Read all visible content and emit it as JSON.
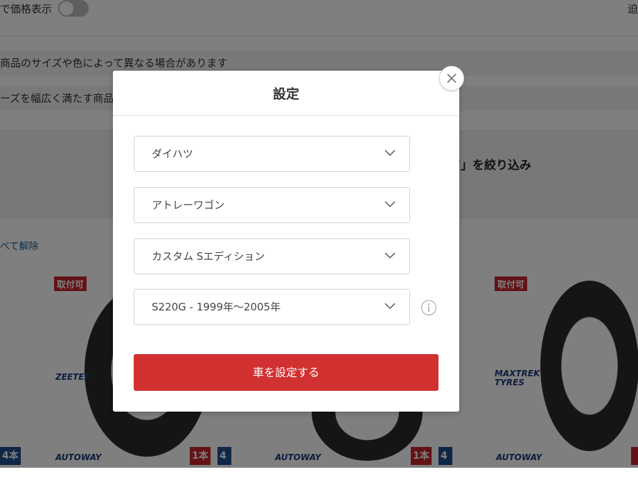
{
  "background": {
    "toggle_label": "で価格表示",
    "top_right_text": "迫",
    "note_1": "商品のサイズや色によって異なる場合があります",
    "note_2": "ーズを幅広く満たす商品は",
    "filter_heading": "ア」を絞り込み",
    "reset_link": "べて解除",
    "products": [
      {
        "badge": "取付可",
        "brand": "ZEETEX",
        "maker": "AUTOWAY",
        "qty_1": "1本",
        "qty_4": "4本"
      },
      {
        "maker": "AUTOWAY",
        "qty_1": "1本",
        "qty_4": "4本"
      },
      {
        "badge": "取付可",
        "brand_line1": "MAXTREK",
        "brand_line2": "TYRES",
        "maker": "AUTOWAY"
      }
    ],
    "left_qty": "4本"
  },
  "modal": {
    "title": "設定",
    "selects": [
      {
        "value": "ダイハツ"
      },
      {
        "value": "アトレーワゴン"
      },
      {
        "value": "カスタム Sエディション"
      },
      {
        "value": "S220G - 1999年〜2005年"
      }
    ],
    "submit_label": "車を設定する"
  },
  "colors": {
    "accent_red": "#d23131",
    "overlay": "rgba(0,0,0,0.5)"
  }
}
